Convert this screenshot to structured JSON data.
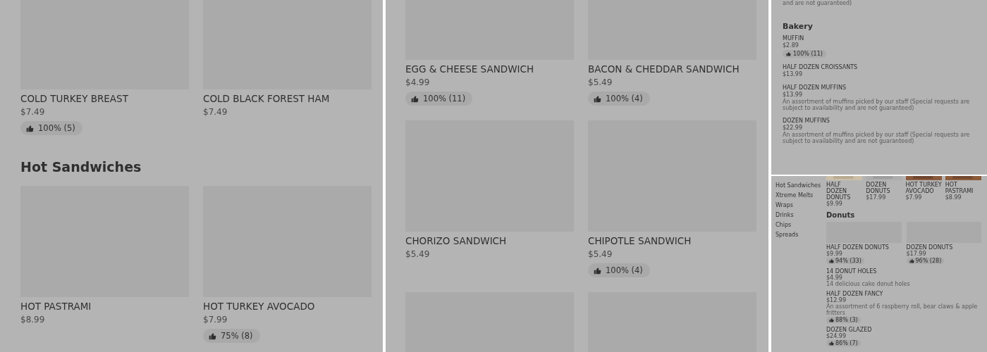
{
  "panels": [
    {
      "kind": "grid",
      "blocks": [
        {
          "kind": "cards",
          "items": [
            {
              "name": "COLD TURKEY BREAST",
              "price": "$7.49",
              "rating": "100% (5)"
            },
            {
              "name": "COLD BLACK FOREST HAM",
              "price": "$7.49"
            }
          ]
        },
        {
          "kind": "heading",
          "text": "Hot Sandwiches"
        },
        {
          "kind": "cards",
          "items": [
            {
              "name": "HOT PASTRAMI",
              "price": "$8.99"
            },
            {
              "name": "HOT TURKEY AVOCADO",
              "price": "$7.99",
              "rating": "75% (8)"
            }
          ]
        }
      ]
    },
    {
      "kind": "grid",
      "blocks": [
        {
          "kind": "cards",
          "items": [
            {
              "name": "EGG & CHEESE SANDWICH",
              "price": "$4.99",
              "rating": "100% (11)"
            },
            {
              "name": "BACON & CHEDDAR SANDWICH",
              "price": "$5.49",
              "rating": "100% (4)"
            }
          ]
        },
        {
          "kind": "cards",
          "items": [
            {
              "name": "CHORIZO SANDWICH",
              "price": "$5.49"
            },
            {
              "name": "CHIPOTLE SANDWICH",
              "price": "$5.49",
              "rating": "100% (4)"
            }
          ]
        },
        {
          "kind": "image_row"
        }
      ]
    },
    {
      "kind": "list",
      "blocks": [
        {
          "kind": "note",
          "text": "and are not guaranteed)"
        },
        {
          "kind": "heading",
          "text": "Bakery"
        },
        {
          "kind": "list",
          "items": [
            {
              "name": "MUFFIN",
              "price": "$2.89",
              "rating": "100% (11)"
            },
            {
              "name": "HALF DOZEN CROISSANTS",
              "price": "$13.99"
            },
            {
              "name": "HALF DOZEN MUFFINS",
              "price": "$13.99",
              "description": "An assortment of muffins picked by our staff (Special requests are subject to availability and are not guaranteed)"
            },
            {
              "name": "DOZEN MUFFINS",
              "price": "$22.99",
              "description": "An assortment of muffins picked by our staff (Special requests are subject to availability and are not guaranteed)"
            }
          ]
        }
      ]
    },
    {
      "kind": "browse",
      "sidebar": [
        "Hot Sandwiches",
        "Xtreme Melts",
        "Wraps",
        "Drinks",
        "Chips",
        "Spreads"
      ],
      "blocks": [
        {
          "kind": "strip",
          "items": [
            {
              "name": "HALF DOZEN DONUTS",
              "price": "$9.99"
            },
            {
              "name": "DOZEN DONUTS",
              "price": "$17.99"
            },
            {
              "name": "HOT TURKEY AVOCADO",
              "price": "$7.99"
            },
            {
              "name": "HOT PASTRAMI",
              "price": "$8.99"
            }
          ]
        },
        {
          "kind": "heading",
          "text": "Donuts"
        },
        {
          "kind": "cards",
          "items": [
            {
              "name": "HALF DOZEN DONUTS",
              "price": "$9.99",
              "rating": "94% (33)"
            },
            {
              "name": "DOZEN DONUTS",
              "price": "$17.99",
              "rating": "96% (28)"
            }
          ]
        },
        {
          "kind": "list",
          "items": [
            {
              "name": "14 DONUT HOLES",
              "price": "$4.99",
              "description": "14 delicious cake donut holes"
            },
            {
              "name": "HALF DOZEN FANCY",
              "price": "$12.99",
              "description": "An assortment of 6 raspberry roll, bear claws & apple fritters",
              "rating": "88% (3)"
            },
            {
              "name": "DOZEN GLAZED",
              "price": "$24.99",
              "rating": "86% (7)"
            }
          ]
        }
      ]
    }
  ]
}
